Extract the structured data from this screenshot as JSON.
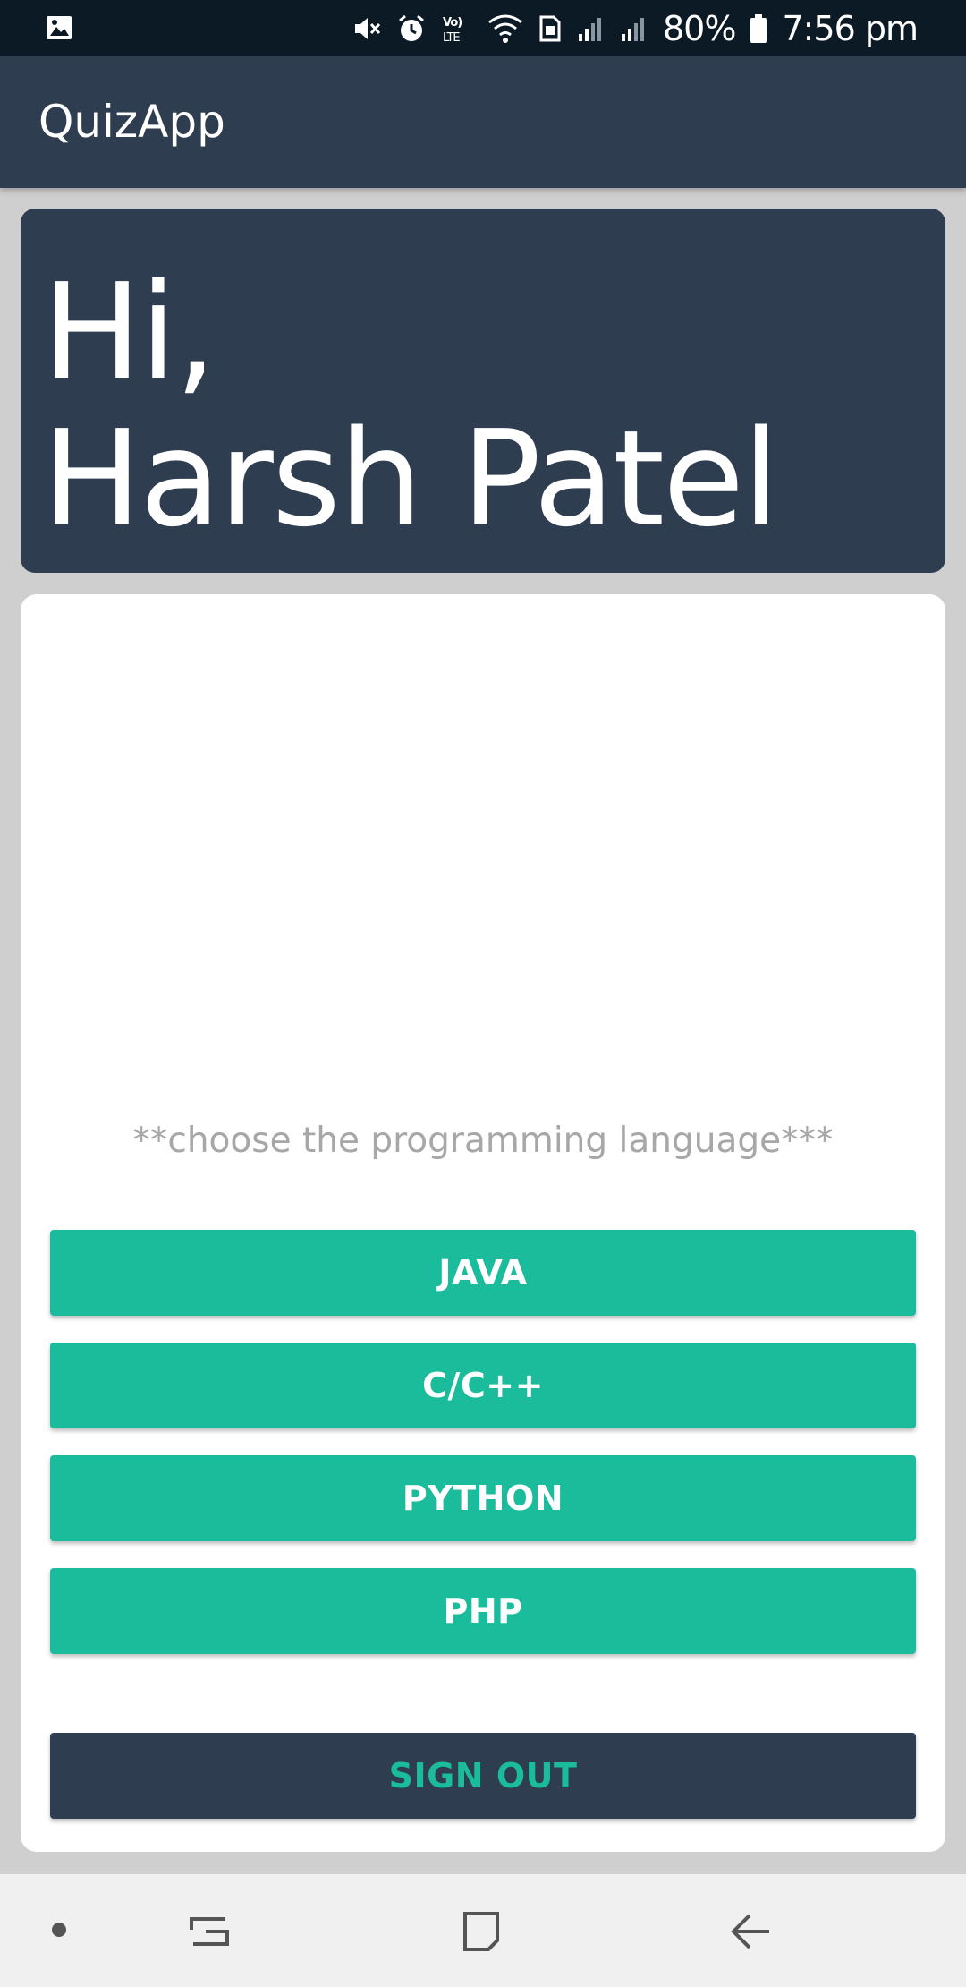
{
  "status_bar": {
    "battery": "80%",
    "time": "7:56 pm",
    "icons": [
      "gallery-notification-icon",
      "mute-icon",
      "alarm-icon",
      "volte-icon",
      "wifi-icon",
      "sim-icon",
      "signal-icon",
      "signal-icon",
      "battery-icon"
    ]
  },
  "app": {
    "title": "QuizApp"
  },
  "greeting": {
    "line1": "Hi,",
    "line2": "Harsh Patel"
  },
  "content": {
    "prompt": "**choose the programming language***",
    "languages": [
      {
        "label": "JAVA"
      },
      {
        "label": "C/C++"
      },
      {
        "label": "PYTHON"
      },
      {
        "label": "PHP"
      }
    ],
    "sign_out_label": "SIGN OUT"
  },
  "colors": {
    "primary": "#2e3d50",
    "accent": "#1bbc9b",
    "status_bar": "#0c1a26",
    "background": "#cfcfcf"
  },
  "nav_bar": {
    "icons": [
      "dot-icon",
      "recent-apps-icon",
      "home-icon",
      "back-icon"
    ]
  }
}
